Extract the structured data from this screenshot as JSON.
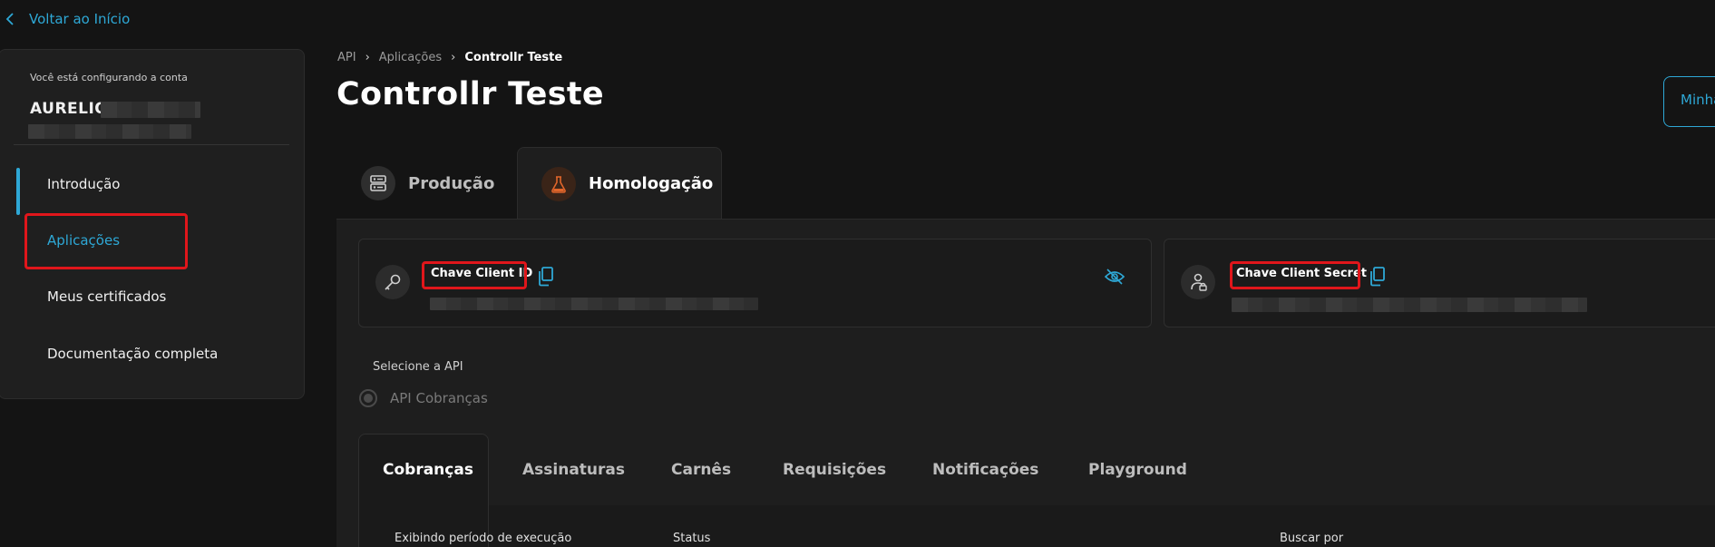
{
  "back": {
    "label": "Voltar ao Início",
    "icon": "chevron-left-icon"
  },
  "sidebar": {
    "caption": "Você está configurando a conta",
    "account_name": "AURELIO",
    "items": [
      {
        "label": "Introdução",
        "active": false
      },
      {
        "label": "Aplicações",
        "active": true
      },
      {
        "label": "Meus certificados",
        "active": false
      },
      {
        "label": "Documentação completa",
        "active": false
      }
    ]
  },
  "breadcrumb": [
    "API",
    "Aplicações",
    "Controllr Teste"
  ],
  "page_title": "Controllr Teste",
  "top_right_button": "Minha",
  "environment_tabs": [
    {
      "label": "Produção",
      "icon": "server-icon",
      "active": false
    },
    {
      "label": "Homologação",
      "icon": "flask-icon",
      "active": true
    }
  ],
  "keys": {
    "client_id": {
      "label": "Chave Client ID",
      "icon": "key-icon"
    },
    "client_secret": {
      "label": "Chave Client Secret",
      "icon": "lock-key-icon"
    }
  },
  "select_api": {
    "label": "Selecione a API",
    "option": "API Cobranças"
  },
  "sub_tabs": [
    "Cobranças",
    "Assinaturas",
    "Carnês",
    "Requisições",
    "Notificações",
    "Playground"
  ],
  "filters": [
    "Exibindo período de execução",
    "Status",
    "Buscar por"
  ],
  "colors": {
    "accent": "#2ea8d6",
    "highlight": "#e0161b",
    "background": "#141414",
    "flask": "#e0652a"
  }
}
